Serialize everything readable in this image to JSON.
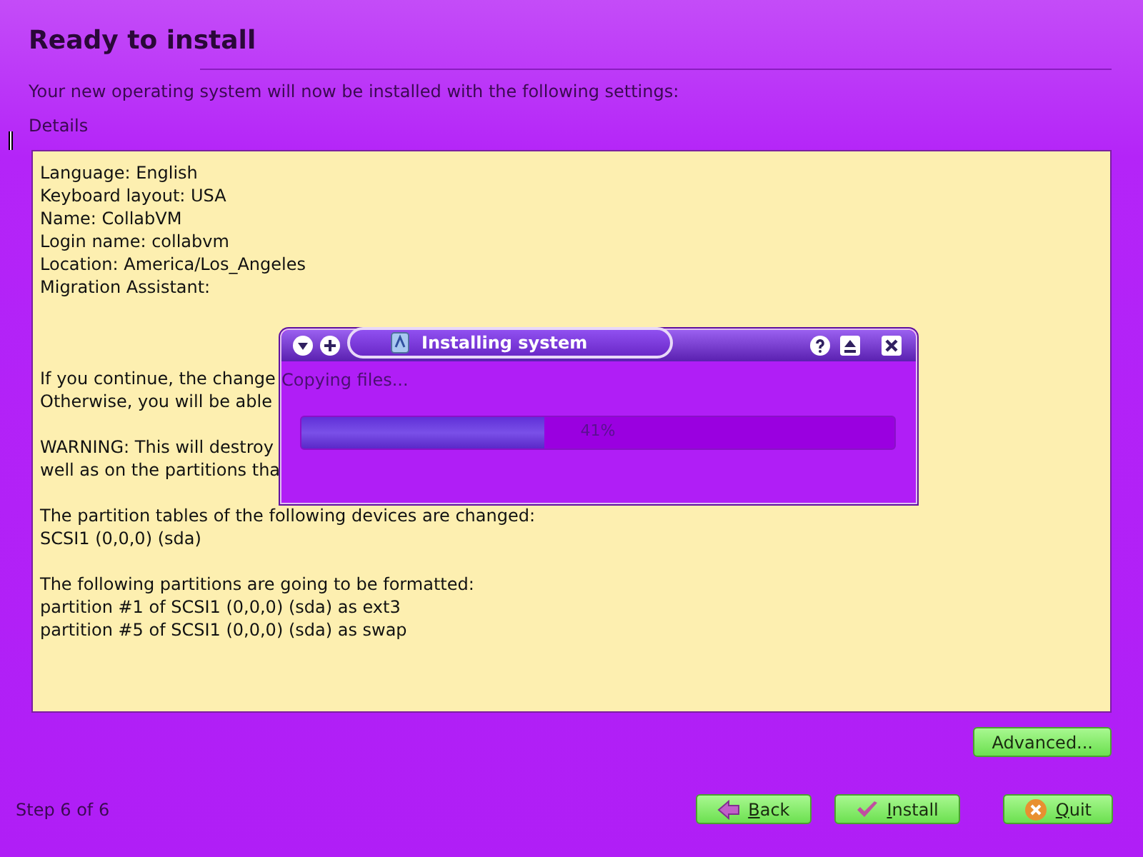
{
  "title": "Ready to install",
  "subtitle": "Your new operating system will now be installed with the following settings:",
  "details_label": "Details",
  "details": [
    [
      "Language: English",
      "Keyboard layout: USA",
      "Name: CollabVM",
      "Login name: collabvm",
      "Location: America/Los_Angeles",
      "Migration Assistant:"
    ],
    [
      "If you continue, the change",
      "Otherwise, you will be able"
    ],
    [
      "WARNING: This will destroy",
      "well as on the partitions tha"
    ],
    [
      "The partition tables of the following devices are changed:",
      "SCSI1 (0,0,0) (sda)"
    ],
    [
      "The following partitions are going to be formatted:",
      "partition #1 of SCSI1 (0,0,0) (sda) as ext3",
      "partition #5 of SCSI1 (0,0,0) (sda) as swap"
    ]
  ],
  "advanced_button": "Advanced...",
  "step": "Step 6 of 6",
  "buttons": [
    {
      "label": "Back",
      "kind": "back"
    },
    {
      "label": "Install",
      "kind": "install"
    },
    {
      "label": "Quit",
      "kind": "quit"
    }
  ],
  "dialog": {
    "title": "Installing system",
    "message": "Copying files...",
    "progress": {
      "level": 0.41,
      "reading": "41%"
    }
  }
}
